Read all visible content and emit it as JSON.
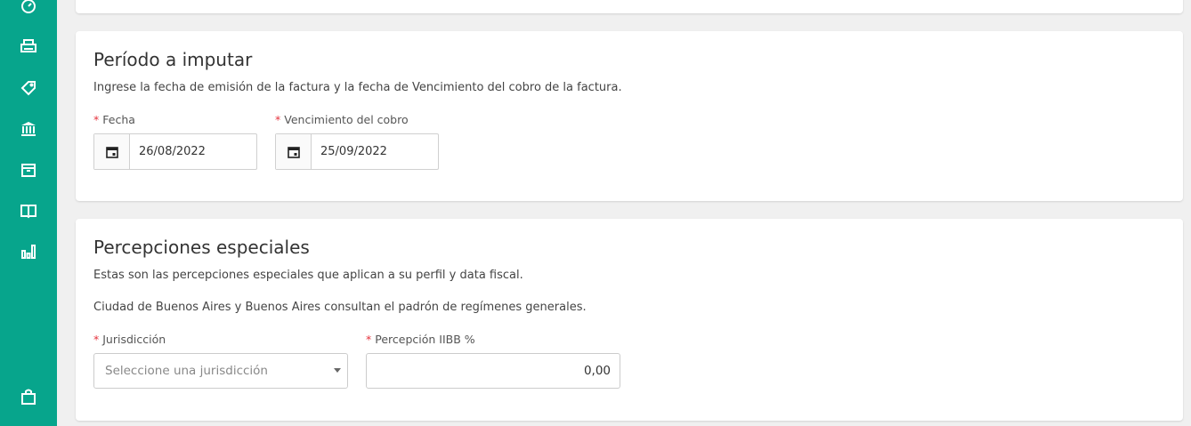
{
  "sidebar": {
    "icons": [
      "dashboard-icon",
      "printer-icon",
      "tag-icon",
      "bank-icon",
      "box-icon",
      "book-icon",
      "bar-chart-icon",
      "shopping-bag-icon"
    ]
  },
  "periodo": {
    "title": "Período a imputar",
    "description": "Ingrese la fecha de emisión de la factura y la fecha de Vencimiento del cobro de la factura.",
    "fecha_label": "Fecha",
    "fecha_value": "26/08/2022",
    "vencimiento_label": "Vencimiento del cobro",
    "vencimiento_value": "25/09/2022"
  },
  "percepciones": {
    "title": "Percepciones especiales",
    "description1": "Estas son las percepciones especiales que aplican a su perfil y data fiscal.",
    "description2": "Ciudad de Buenos Aires y Buenos Aires consultan el padrón de regímenes generales.",
    "jurisdiccion_label": "Jurisdicción",
    "jurisdiccion_placeholder": "Seleccione una jurisdicción",
    "percepcion_label": "Percepción IIBB %",
    "percepcion_value": "0,00"
  },
  "colors": {
    "sidebar": "#07a58c",
    "required": "#e5333d"
  }
}
